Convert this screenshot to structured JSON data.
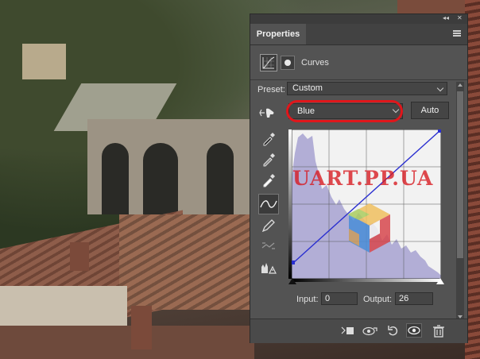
{
  "panel": {
    "tab_label": "Properties",
    "adjustment_title": "Curves",
    "preset_label": "Preset:",
    "preset_value": "Custom",
    "channel_value": "Blue",
    "auto_label": "Auto",
    "input_label": "Input:",
    "input_value": "0",
    "output_label": "Output:",
    "output_value": "26"
  },
  "watermark": {
    "text": "UART.PP.UA"
  },
  "colors": {
    "panel_bg": "#535353",
    "highlight": "#e0161b",
    "histogram": "#b2aed6",
    "curve": "#2a2fd0",
    "watermark": "#d8181e"
  },
  "icons": {
    "curves": "curves-grid-icon",
    "mask": "mask-icon",
    "hand": "on-image-adjust-icon",
    "eyedropper_black": "eyedropper-black-icon",
    "eyedropper_gray": "eyedropper-gray-icon",
    "eyedropper_white": "eyedropper-white-icon",
    "curve_tool": "curve-points-icon",
    "pencil": "pencil-icon",
    "smooth": "smooth-curve-icon",
    "clipping": "clipping-warning-icon",
    "clip_layer": "clip-to-layer-icon",
    "view_previous": "view-previous-icon",
    "reset": "reset-icon",
    "visibility": "eye-icon",
    "delete": "trash-icon"
  }
}
